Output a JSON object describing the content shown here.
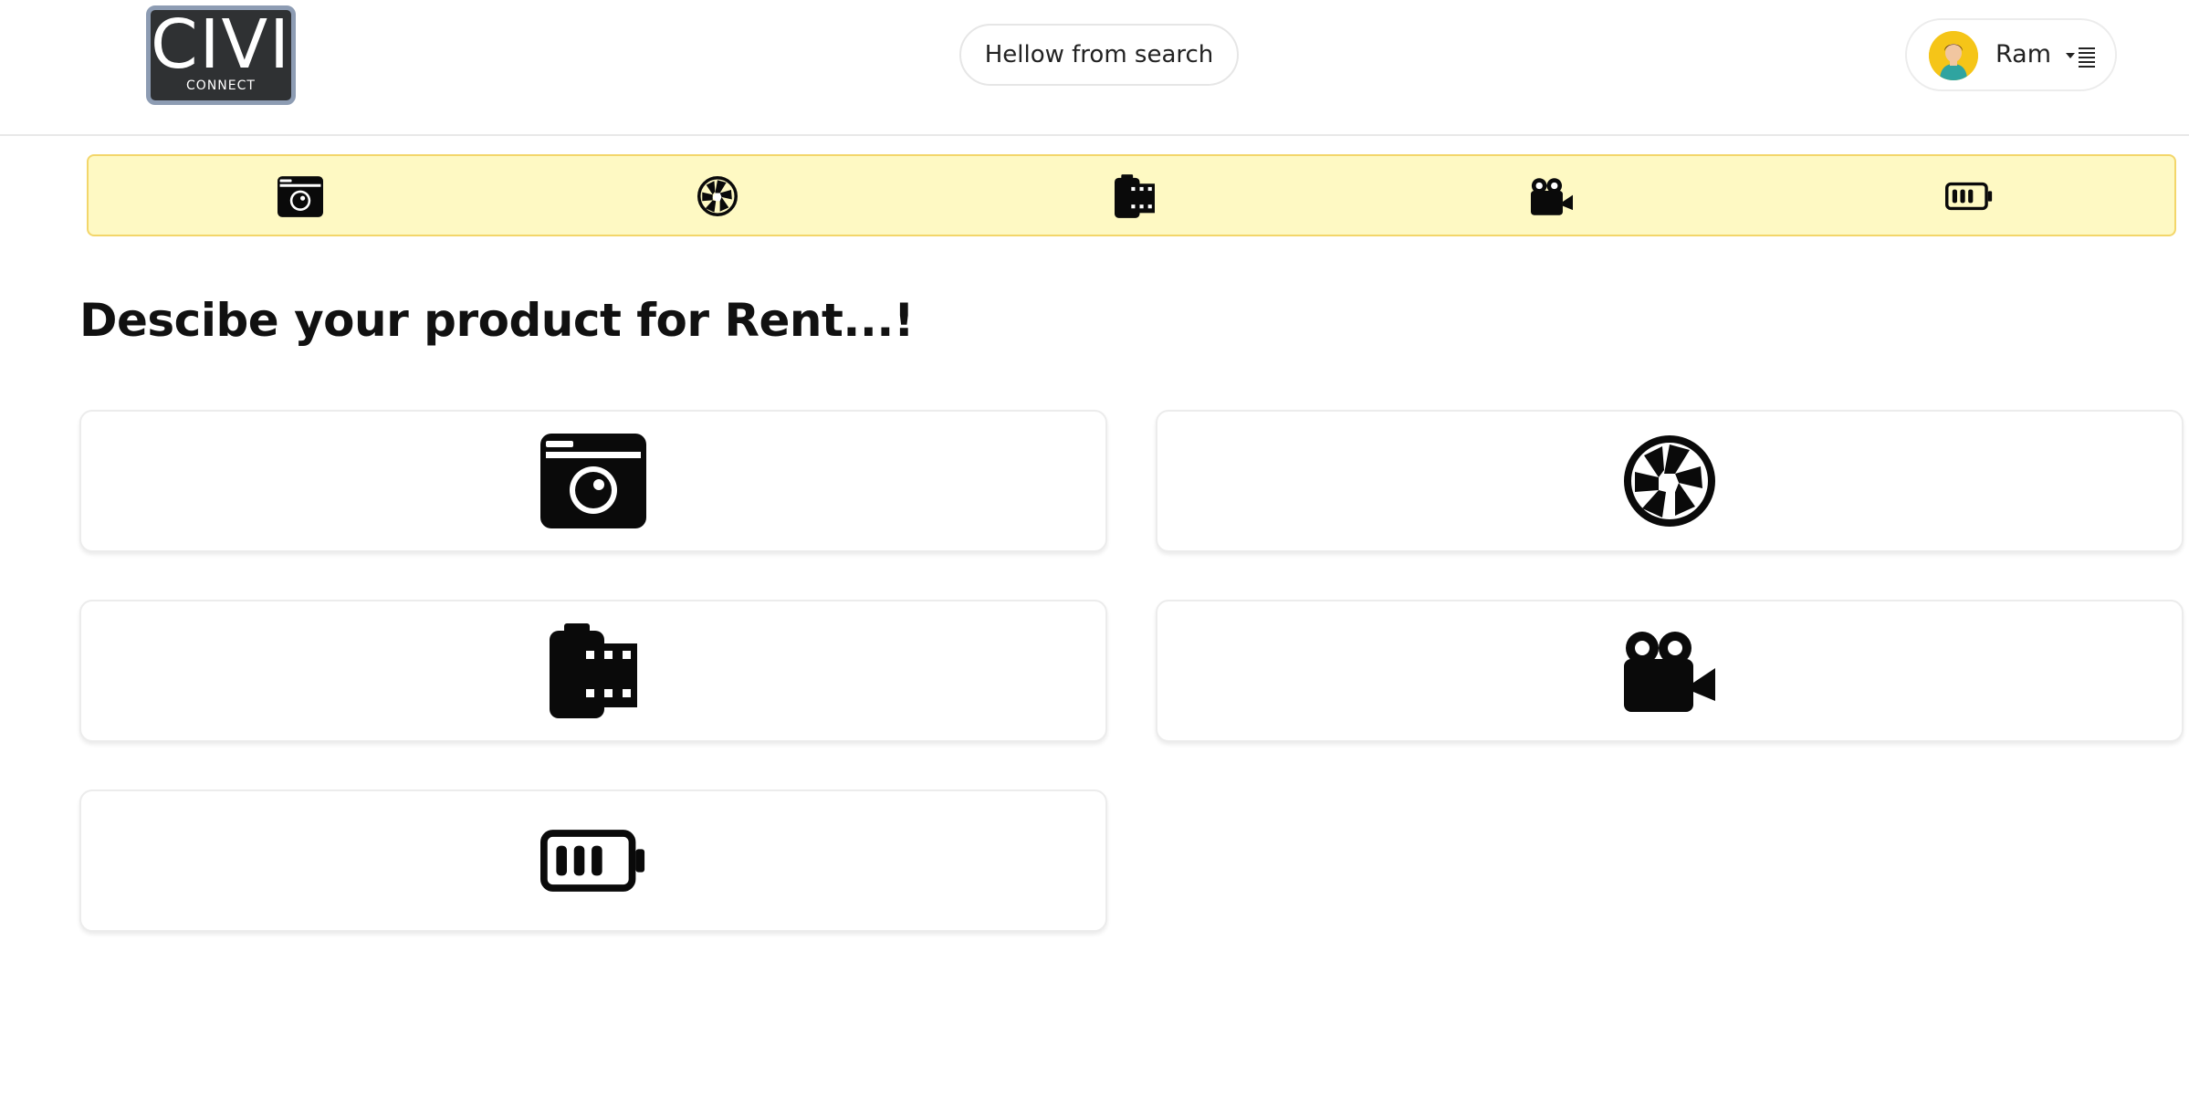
{
  "header": {
    "logo": {
      "main": "CIVI",
      "sub": "CONNECT"
    },
    "search": {
      "text": "Hellow from search"
    },
    "user": {
      "name": "Ram",
      "avatar_icon": "user-avatar-icon",
      "menu_icon": "dropdown-menu-icon"
    }
  },
  "category_bar": {
    "background": "#fef9c3",
    "border": "#f3d66a",
    "items": [
      {
        "icon": "camera-icon"
      },
      {
        "icon": "aperture-icon"
      },
      {
        "icon": "film-roll-icon"
      },
      {
        "icon": "video-camera-icon"
      },
      {
        "icon": "battery-icon"
      }
    ]
  },
  "main": {
    "title": "Descibe your product for Rent...!",
    "cards": [
      {
        "icon": "camera-icon"
      },
      {
        "icon": "aperture-icon"
      },
      {
        "icon": "film-roll-icon"
      },
      {
        "icon": "video-camera-icon"
      },
      {
        "icon": "battery-icon"
      }
    ]
  }
}
